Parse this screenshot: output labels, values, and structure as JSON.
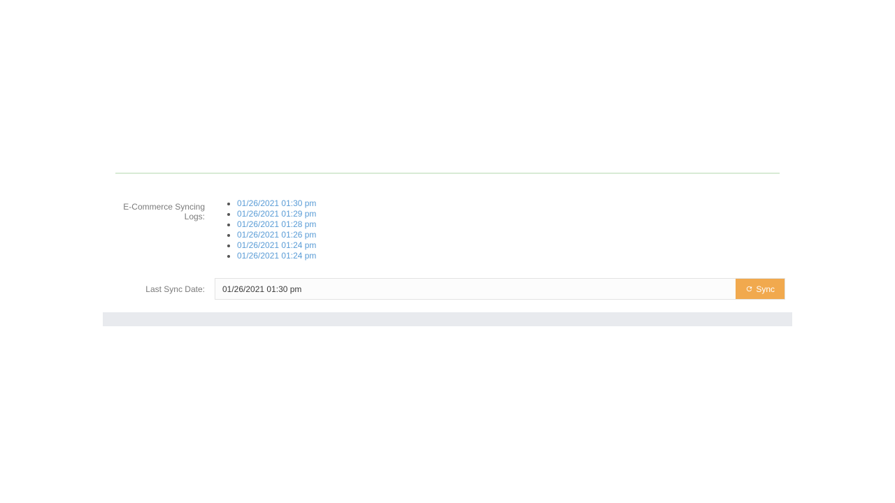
{
  "logs": {
    "label": "E-Commerce Syncing Logs:",
    "items": [
      "01/26/2021 01:30 pm",
      "01/26/2021 01:29 pm",
      "01/26/2021 01:28 pm",
      "01/26/2021 01:26 pm",
      "01/26/2021 01:24 pm",
      "01/26/2021 01:24 pm"
    ]
  },
  "last_sync": {
    "label": "Last Sync Date:",
    "value": "01/26/2021 01:30 pm",
    "button_label": "Sync"
  }
}
